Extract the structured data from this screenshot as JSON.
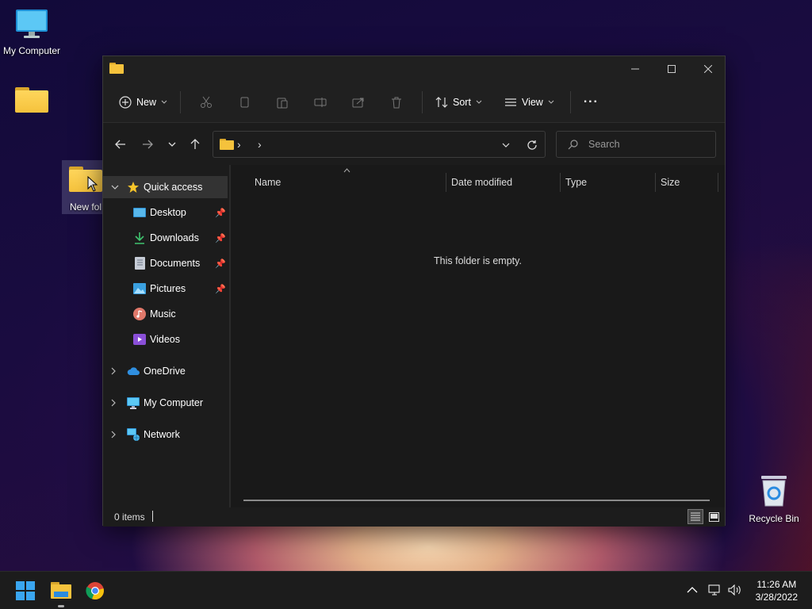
{
  "desktop": {
    "icons": [
      {
        "label": "My Computer"
      },
      {
        "label": ""
      },
      {
        "label": "New fol"
      },
      {
        "label": "Recycle Bin"
      }
    ]
  },
  "window": {
    "toolbar": {
      "new_label": "New",
      "sort_label": "Sort",
      "view_label": "View",
      "more_label": "···"
    },
    "nav": {
      "address_sep1": "›",
      "address_sep2": "›",
      "search_placeholder": "Search"
    },
    "sidebar": {
      "quick_access": "Quick access",
      "items": [
        {
          "label": "Desktop",
          "icon": "desktop-icon",
          "pinned": true
        },
        {
          "label": "Downloads",
          "icon": "download-icon",
          "pinned": true
        },
        {
          "label": "Documents",
          "icon": "document-icon",
          "pinned": true
        },
        {
          "label": "Pictures",
          "icon": "pictures-icon",
          "pinned": true
        },
        {
          "label": "Music",
          "icon": "music-icon",
          "pinned": false
        },
        {
          "label": "Videos",
          "icon": "videos-icon",
          "pinned": false
        }
      ],
      "roots": [
        {
          "label": "OneDrive",
          "icon": "cloud-icon"
        },
        {
          "label": "My Computer",
          "icon": "computer-icon"
        },
        {
          "label": "Network",
          "icon": "network-icon"
        }
      ]
    },
    "content": {
      "columns": [
        "Name",
        "Date modified",
        "Type",
        "Size"
      ],
      "empty_message": "This folder is empty."
    },
    "status": {
      "item_count": "0 items"
    }
  },
  "taskbar": {
    "time": "11:26 AM",
    "date": "3/28/2022"
  },
  "colors": {
    "folder_yellow": "#f5c23c",
    "window_bg": "#1c1c1c",
    "accent_blue": "#4cc2ff"
  }
}
